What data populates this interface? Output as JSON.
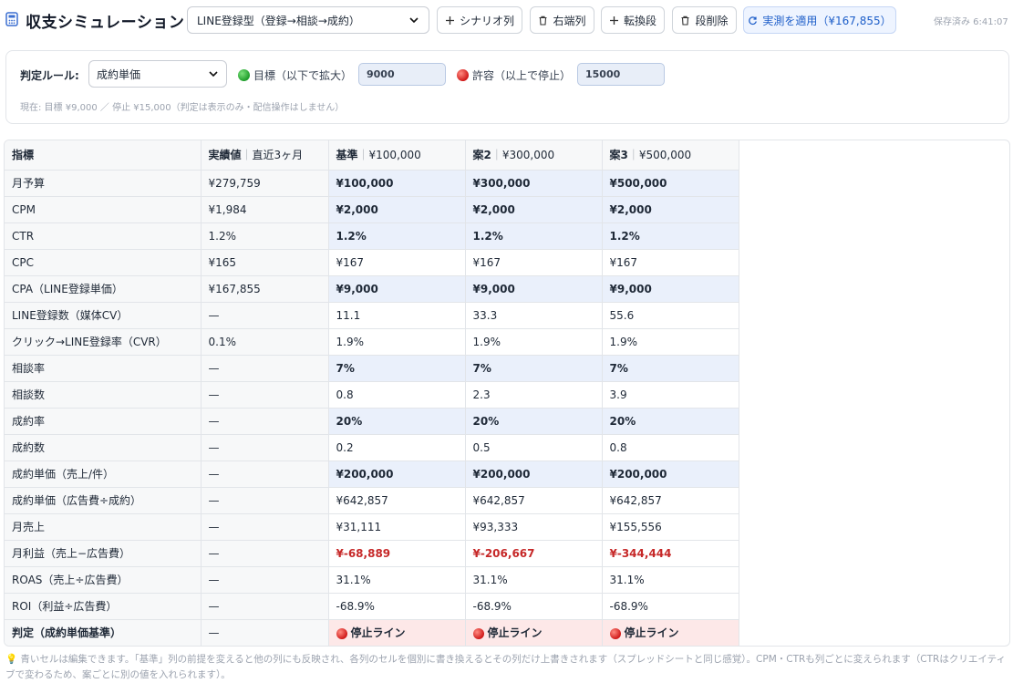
{
  "app": {
    "title": "収支シミュレーション",
    "scenario_value": "LINE登録型（登録→相談→成約）",
    "saved_text": "保存済み 6:41:07",
    "icons": {
      "app": "calculator-icon",
      "chevron": "chevron-down-icon"
    }
  },
  "toolbar": {
    "add_col_label": "シナリオ列",
    "del_right_label": "右端列",
    "insert_row_label": "転換段",
    "del_row_label": "段削除",
    "apply_label": "実測を適用（¥167,855）",
    "icons": {
      "plus": "plus-icon",
      "trash": "trash-icon",
      "refresh": "refresh-icon"
    }
  },
  "rule": {
    "label": "判定ルール:",
    "select_value": "成約単価",
    "target_label": "目標（以下で拡大）",
    "target_value": "9000",
    "limit_label": "許容（以上で停止）",
    "limit_value": "15000",
    "note": "現在: 目標 ¥9,000 ／ 停止 ¥15,000（判定は表示のみ・配信操作はしません）"
  },
  "table": {
    "headers": {
      "metric": "指標",
      "actual": "実績値",
      "actual_sub": "直近3ヶ月",
      "cols": [
        {
          "name": "基準",
          "budget": "¥100,000"
        },
        {
          "name": "案2",
          "budget": "¥300,000"
        },
        {
          "name": "案3",
          "budget": "¥500,000"
        }
      ]
    },
    "rows": [
      {
        "metric": "月予算",
        "actual": "¥279,759",
        "values": [
          "¥100,000",
          "¥300,000",
          "¥500,000"
        ]
      },
      {
        "metric": "CPM",
        "actual": "¥1,984",
        "values": [
          "¥2,000",
          "¥2,000",
          "¥2,000"
        ]
      },
      {
        "metric": "CTR",
        "actual": "1.2%",
        "values": [
          "1.2%",
          "1.2%",
          "1.2%"
        ]
      },
      {
        "metric": "CPC",
        "actual": "¥165",
        "values": [
          "¥167",
          "¥167",
          "¥167"
        ]
      },
      {
        "metric": "CPA（LINE登録単価）",
        "actual": "¥167,855",
        "values": [
          "¥9,000",
          "¥9,000",
          "¥9,000"
        ]
      },
      {
        "metric": "LINE登録数（媒体CV）",
        "actual": "—",
        "values": [
          "11.1",
          "33.3",
          "55.6"
        ]
      },
      {
        "metric": "クリック→LINE登録率（CVR）",
        "actual": "0.1%",
        "values": [
          "1.9%",
          "1.9%",
          "1.9%"
        ]
      },
      {
        "metric": "相談率",
        "actual": "—",
        "values": [
          "7%",
          "7%",
          "7%"
        ]
      },
      {
        "metric": "相談数",
        "actual": "—",
        "values": [
          "0.8",
          "2.3",
          "3.9"
        ]
      },
      {
        "metric": "成約率",
        "actual": "—",
        "values": [
          "20%",
          "20%",
          "20%"
        ]
      },
      {
        "metric": "成約数",
        "actual": "—",
        "values": [
          "0.2",
          "0.5",
          "0.8"
        ]
      },
      {
        "metric": "成約単価（売上/件）",
        "actual": "—",
        "values": [
          "¥200,000",
          "¥200,000",
          "¥200,000"
        ]
      },
      {
        "metric": "成約単価（広告費÷成約）",
        "actual": "—",
        "values": [
          "¥642,857",
          "¥642,857",
          "¥642,857"
        ]
      },
      {
        "metric": "月売上",
        "actual": "—",
        "values": [
          "¥31,111",
          "¥93,333",
          "¥155,556"
        ]
      },
      {
        "metric": "月利益（売上−広告費）",
        "actual": "—",
        "values": [
          "¥-68,889",
          "¥-206,667",
          "¥-344,444"
        ]
      },
      {
        "metric": "ROAS（売上÷広告費）",
        "actual": "—",
        "values": [
          "31.1%",
          "31.1%",
          "31.1%"
        ]
      },
      {
        "metric": "ROI（利益÷広告費）",
        "actual": "—",
        "values": [
          "-68.9%",
          "-68.9%",
          "-68.9%"
        ]
      },
      {
        "metric": "判定（成約単価基準）",
        "actual": "—",
        "values": [
          "停止ライン",
          "停止ライン",
          "停止ライン"
        ]
      }
    ],
    "editable_rows": [
      0,
      1,
      2,
      4,
      7,
      9,
      11
    ],
    "loss_rows": [
      14
    ],
    "verdict_rows": [
      17
    ]
  },
  "footer": {
    "note": "青いセルは編集できます。「基準」列の前提を変えると他の列にも反映され、各列のセルを個別に書き換えるとその列だけ上書きされます（スプレッドシートと同じ感覚）。CPM・CTRも列ごとに変えられます（CTRはクリエイティブで変わるため、案ごとに別の値を入れられます）。",
    "icon": "lightbulb-icon"
  },
  "colors": {
    "editable_bg": "#eaf0fb",
    "loss_text": "#c62828",
    "verdict_bg": "#fde8e8",
    "apply_text": "#1d5ec9"
  }
}
